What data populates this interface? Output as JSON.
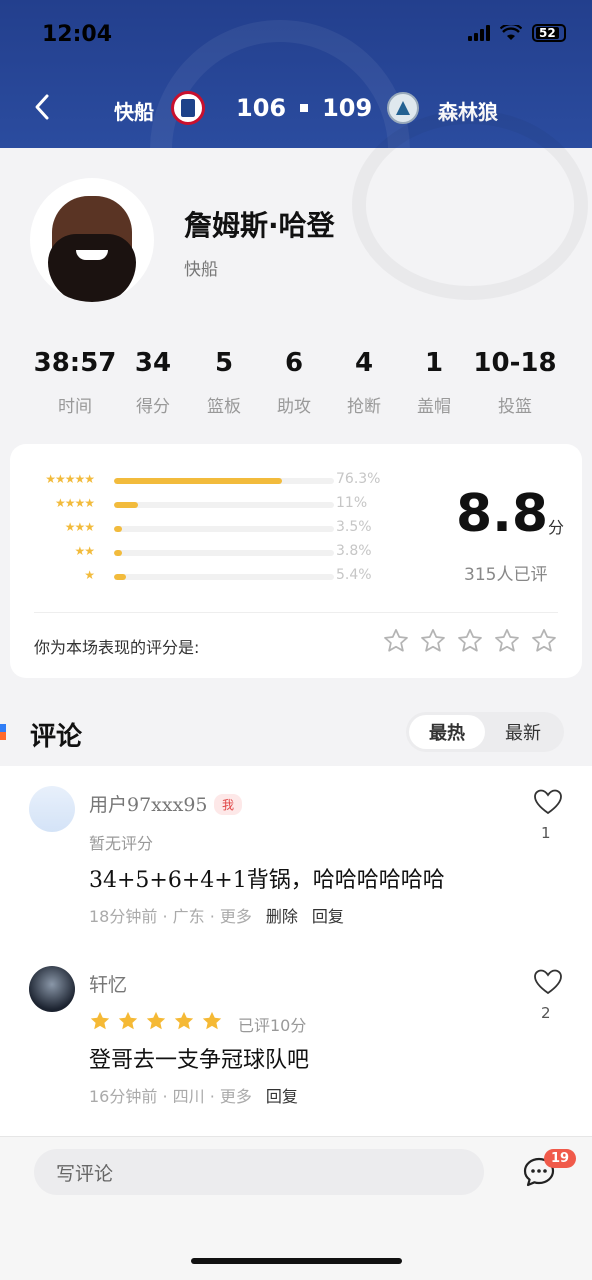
{
  "status_bar": {
    "time": "12:04",
    "battery": "52"
  },
  "header": {
    "team_home": "快船",
    "score_home": "106",
    "score_away": "109",
    "team_away": "森林狼",
    "bg_color": "#2b4c9f"
  },
  "player": {
    "name": "詹姆斯·哈登",
    "team": "快船"
  },
  "stats": [
    {
      "value": "38:57",
      "label": "时间"
    },
    {
      "value": "34",
      "label": "得分"
    },
    {
      "value": "5",
      "label": "篮板"
    },
    {
      "value": "6",
      "label": "助攻"
    },
    {
      "value": "4",
      "label": "抢断"
    },
    {
      "value": "1",
      "label": "盖帽"
    },
    {
      "value": "10-18",
      "label": "投篮"
    }
  ],
  "rating": {
    "distribution": [
      {
        "stars": "★★★★★",
        "percent": "76.3%",
        "fraction": 0.763
      },
      {
        "stars": "★★★★",
        "percent": "11%",
        "fraction": 0.11
      },
      {
        "stars": "★★★",
        "percent": "3.5%",
        "fraction": 0.035
      },
      {
        "stars": "★★",
        "percent": "3.8%",
        "fraction": 0.038
      },
      {
        "stars": "★",
        "percent": "5.4%",
        "fraction": 0.054
      }
    ],
    "score": "8.8",
    "unit": "分",
    "raters": "315人已评",
    "your_rating_label": "你为本场表现的评分是:",
    "accent_color": "#f2bb3c"
  },
  "comments": {
    "title": "评论",
    "sort_hot": "最热",
    "sort_new": "最新",
    "items": [
      {
        "user": "用户97xxx95",
        "badge": "我",
        "sub": "暂无评分",
        "text": "34+5+6+4+1背锅，哈哈哈哈哈哈",
        "meta": "18分钟前 · 广东 · 更多",
        "actions": [
          "删除",
          "回复"
        ],
        "likes": "1"
      },
      {
        "user": "轩忆",
        "rating_note": "已评10分",
        "rating_stars": 5,
        "text": "登哥去一支争冠球队吧",
        "meta": "16分钟前 · 四川 · 更多",
        "actions": [
          "回复"
        ],
        "likes": "2"
      }
    ]
  },
  "bottom_bar": {
    "write_placeholder": "写评论",
    "unread_count": "19"
  }
}
